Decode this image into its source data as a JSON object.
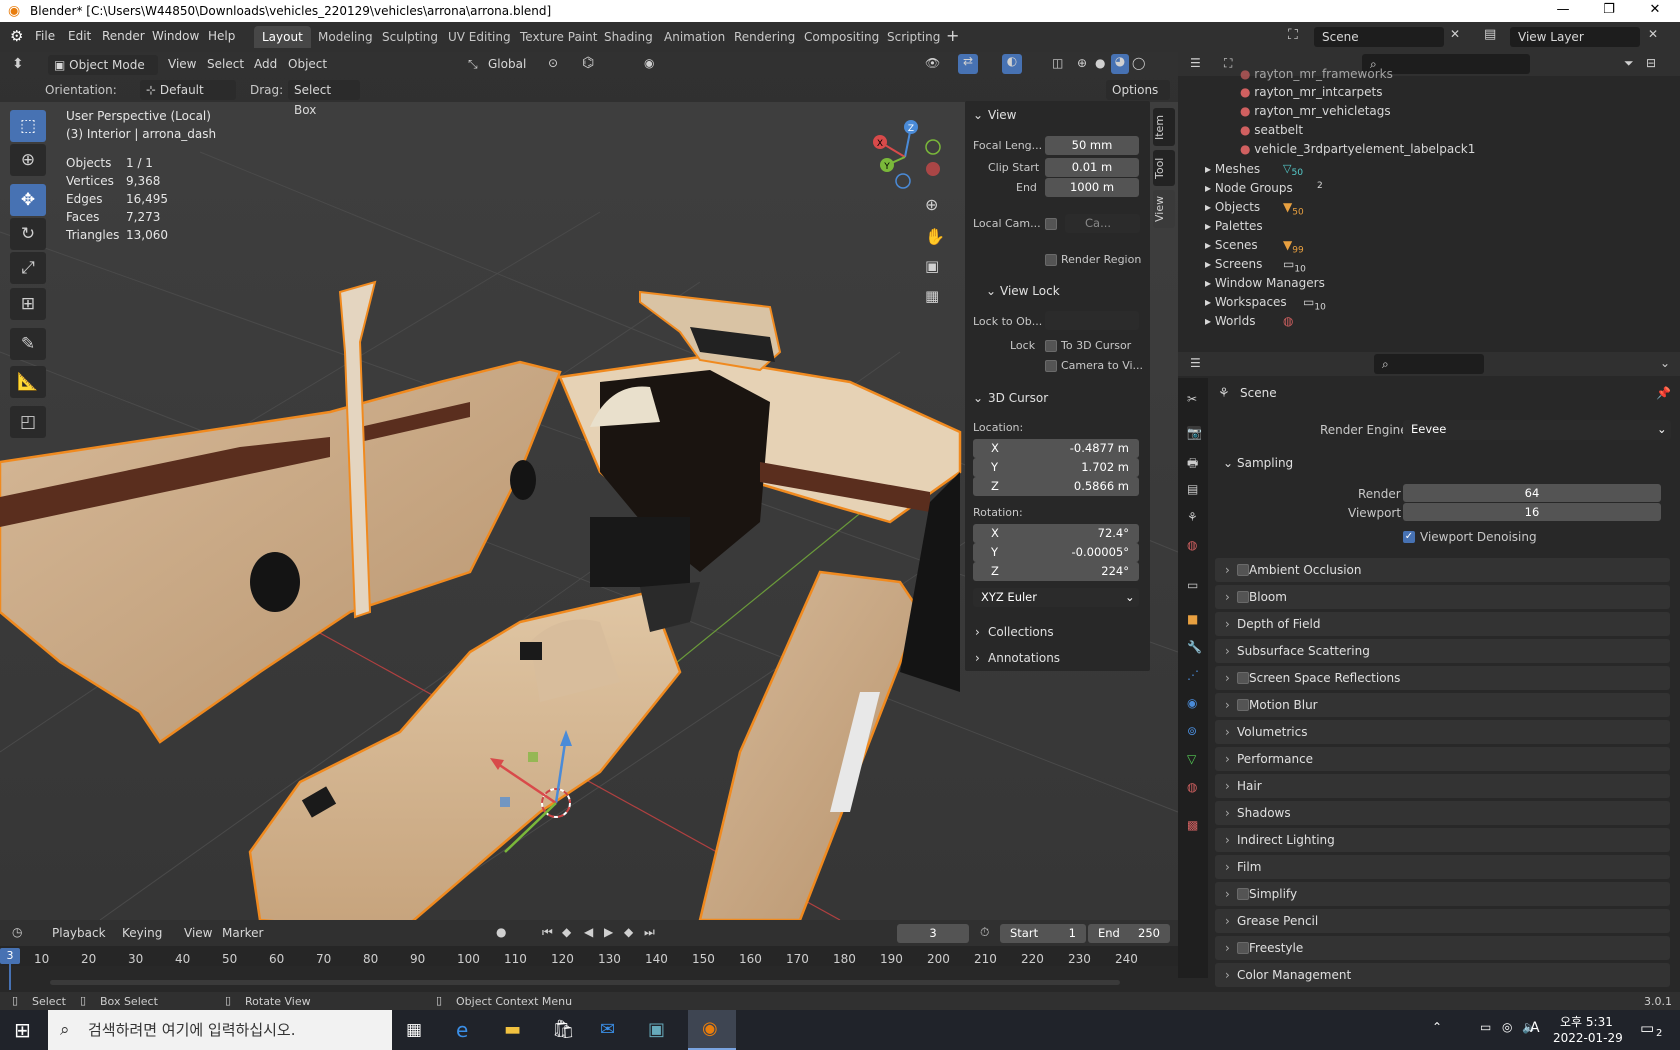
{
  "title_bar": {
    "title": "Blender* [C:\\Users\\W44850\\Downloads\\vehicles_220129\\vehicles\\arrona\\arrona.blend]",
    "minimize": "—",
    "maximize": "❐",
    "close": "✕"
  },
  "menu": [
    "File",
    "Edit",
    "Render",
    "Window",
    "Help"
  ],
  "workspaces": [
    "Layout",
    "Modeling",
    "Sculpting",
    "UV Editing",
    "Texture Paint",
    "Shading",
    "Animation",
    "Rendering",
    "Compositing",
    "Scripting"
  ],
  "active_workspace": "Layout",
  "scene_field": "Scene",
  "view_layer_field": "View Layer",
  "viewport": {
    "mode": "Object Mode",
    "menus": [
      "View",
      "Select",
      "Add",
      "Object"
    ],
    "transform_orientation": "Global",
    "orientation_label": "Orientation:",
    "orientation_value": "Default",
    "drag_label": "Drag:",
    "drag_value": "Select Box",
    "options": "Options",
    "overlay_line1": "User Perspective (Local)",
    "overlay_line2": "(3) Interior | arrona_dash",
    "stats": [
      {
        "label": "Objects",
        "value": "1 / 1"
      },
      {
        "label": "Vertices",
        "value": "9,368"
      },
      {
        "label": "Edges",
        "value": "16,495"
      },
      {
        "label": "Faces",
        "value": "7,273"
      },
      {
        "label": "Triangles",
        "value": "13,060"
      }
    ],
    "gizmo": {
      "x": "X",
      "y": "Y",
      "z": "Z"
    }
  },
  "npanel": {
    "tabs": [
      "Item",
      "Tool",
      "View"
    ],
    "view_title": "View",
    "focal_label": "Focal Leng...",
    "focal_value": "50 mm",
    "clip_start_label": "Clip Start",
    "clip_start_value": "0.01 m",
    "end_label": "End",
    "end_value": "1000 m",
    "local_cam_label": "Local Cam...",
    "local_cam_value": "Ca...",
    "render_region": "Render Region",
    "view_lock_title": "View Lock",
    "lock_to_label": "Lock to Ob...",
    "lock_label": "Lock",
    "to_3d_cursor": "To 3D Cursor",
    "camera_to_view": "Camera to Vi...",
    "cursor_title": "3D Cursor",
    "location_label": "Location:",
    "loc": [
      {
        "axis": "X",
        "value": "-0.4877 m"
      },
      {
        "axis": "Y",
        "value": "1.702 m"
      },
      {
        "axis": "Z",
        "value": "0.5866 m"
      }
    ],
    "rotation_label": "Rotation:",
    "rot": [
      {
        "axis": "X",
        "value": "72.4°"
      },
      {
        "axis": "Y",
        "value": "-0.00005°"
      },
      {
        "axis": "Z",
        "value": "224°"
      }
    ],
    "rot_mode": "XYZ Euler",
    "collections": "Collections",
    "annotations": "Annotations"
  },
  "outliner": {
    "materials": [
      "rayton_mr_frameworks",
      "rayton_mr_intcarpets",
      "rayton_mr_vehicletags",
      "seatbelt",
      "vehicle_3rdpartyelement_labelpack1"
    ],
    "categories": [
      {
        "name": "Meshes",
        "badge": "50"
      },
      {
        "name": "Node Groups",
        "badge": "2"
      },
      {
        "name": "Objects",
        "badge": "50"
      },
      {
        "name": "Palettes",
        "badge": ""
      },
      {
        "name": "Scenes",
        "badge": "99"
      },
      {
        "name": "Screens",
        "badge": "10"
      },
      {
        "name": "Window Managers",
        "badge": ""
      },
      {
        "name": "Workspaces",
        "badge": "10"
      },
      {
        "name": "Worlds",
        "badge": ""
      }
    ]
  },
  "properties": {
    "scene_label": "Scene",
    "render_engine_label": "Render Engine",
    "render_engine_value": "Eevee",
    "sampling": "Sampling",
    "render_label": "Render",
    "render_value": "64",
    "viewport_label": "Viewport",
    "viewport_value": "16",
    "viewport_denoising": "Viewport Denoising",
    "sections": [
      {
        "name": "Ambient Occlusion",
        "checkbox": true
      },
      {
        "name": "Bloom",
        "checkbox": true
      },
      {
        "name": "Depth of Field",
        "checkbox": false
      },
      {
        "name": "Subsurface Scattering",
        "checkbox": false
      },
      {
        "name": "Screen Space Reflections",
        "checkbox": true
      },
      {
        "name": "Motion Blur",
        "checkbox": true
      },
      {
        "name": "Volumetrics",
        "checkbox": false
      },
      {
        "name": "Performance",
        "checkbox": false
      },
      {
        "name": "Hair",
        "checkbox": false
      },
      {
        "name": "Shadows",
        "checkbox": false
      },
      {
        "name": "Indirect Lighting",
        "checkbox": false
      },
      {
        "name": "Film",
        "checkbox": false
      },
      {
        "name": "Simplify",
        "checkbox": true
      },
      {
        "name": "Grease Pencil",
        "checkbox": false
      },
      {
        "name": "Freestyle",
        "checkbox": true
      },
      {
        "name": "Color Management",
        "checkbox": false
      }
    ]
  },
  "timeline": {
    "menus": [
      "Playback",
      "Keying",
      "View",
      "Marker"
    ],
    "current_frame": "3",
    "start_label": "Start",
    "start_value": "1",
    "end_label": "End",
    "end_value": "250",
    "ticks": [
      "10",
      "20",
      "30",
      "40",
      "50",
      "60",
      "70",
      "80",
      "90",
      "100",
      "110",
      "120",
      "130",
      "140",
      "150",
      "160",
      "170",
      "180",
      "190",
      "200",
      "210",
      "220",
      "230",
      "240"
    ],
    "playhead": "3"
  },
  "status_bar": {
    "select": "Select",
    "box_select": "Box Select",
    "rotate_view": "Rotate View",
    "context_menu": "Object Context Menu",
    "version": "3.0.1"
  },
  "taskbar": {
    "search_placeholder": "검색하려면 여기에 입력하십시오.",
    "time": "오후 5:31",
    "date": "2022-01-29",
    "notif": "2",
    "ime": "A"
  }
}
